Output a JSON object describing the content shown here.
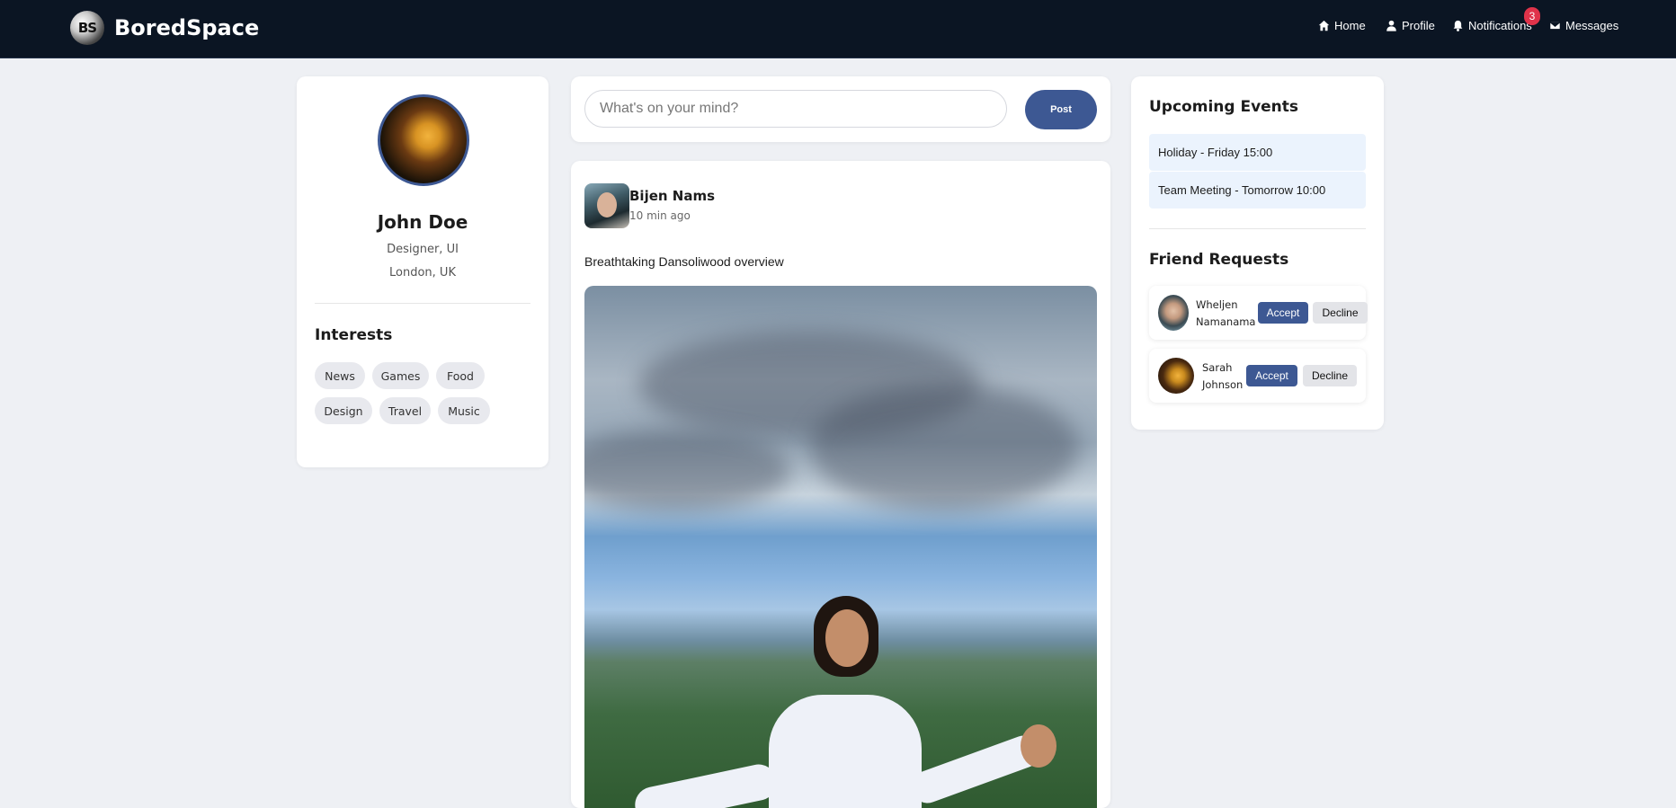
{
  "app": {
    "brand_initials": "BS",
    "brand_name": "BoredSpace"
  },
  "nav": {
    "home": "Home",
    "profile": "Profile",
    "notifications": "Notifications",
    "notifications_count": "3",
    "messages": "Messages"
  },
  "profile": {
    "name": "John Doe",
    "role": "Designer, UI",
    "location": "London, UK",
    "interests_title": "Interests",
    "interests": [
      "News",
      "Games",
      "Food",
      "Design",
      "Travel",
      "Music"
    ]
  },
  "composer": {
    "placeholder": "What's on your mind?",
    "post_label": "Post"
  },
  "post": {
    "author": "Bijen Nams",
    "time": "10 min ago",
    "text": "Breathtaking Dansoliwood overview"
  },
  "events": {
    "title": "Upcoming Events",
    "items": [
      "Holiday - Friday 15:00",
      "Team Meeting - Tomorrow 10:00"
    ]
  },
  "friend_requests": {
    "title": "Friend Requests",
    "items": [
      {
        "first": "Wheljen",
        "last": "Namanama",
        "accept": "Accept",
        "decline": "Decline"
      },
      {
        "first": "Sarah",
        "last": "Johnson",
        "accept": "Accept",
        "decline": "Decline"
      }
    ]
  },
  "colors": {
    "accent": "#3d5893",
    "topbar": "#0b1523",
    "badge": "#e0334a",
    "event_bg": "#ebf3fd"
  }
}
